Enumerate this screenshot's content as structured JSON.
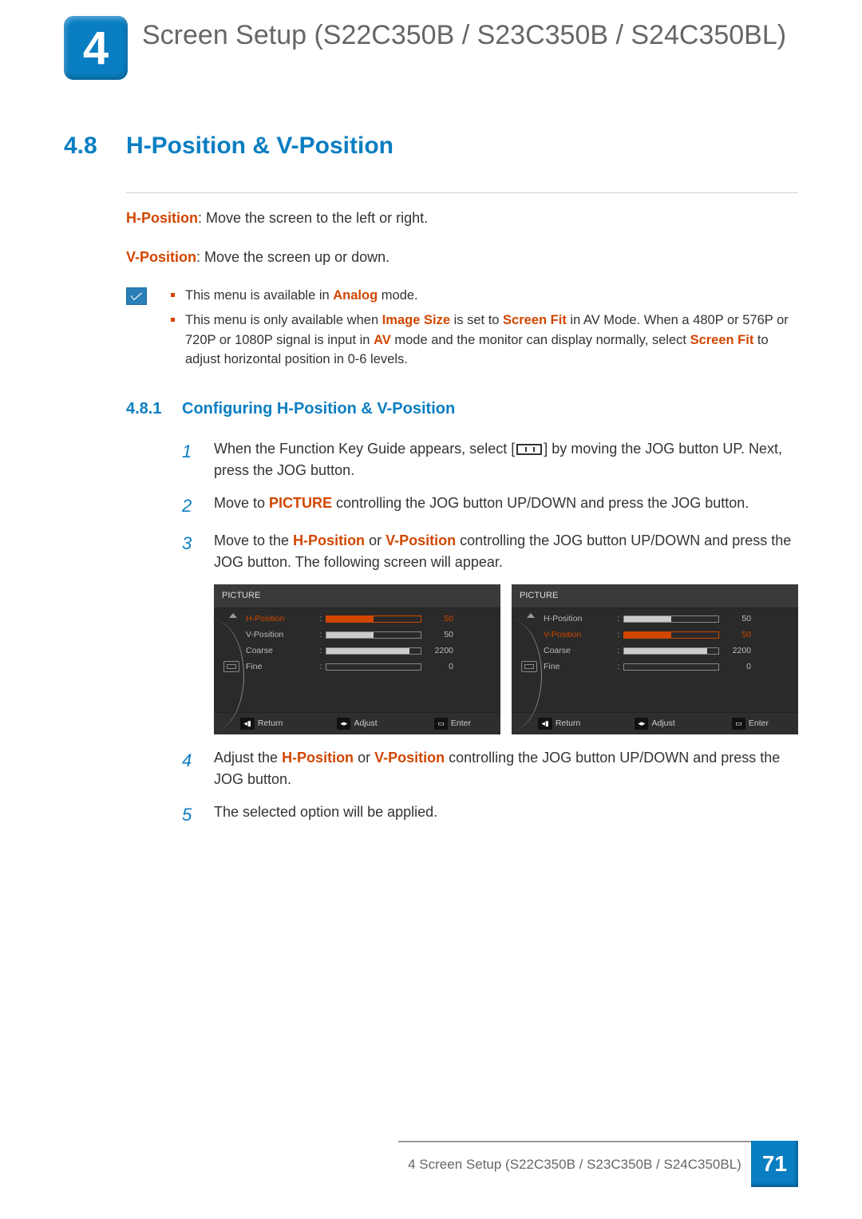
{
  "chapter": {
    "number": "4",
    "title": "Screen Setup (S22C350B / S23C350B / S24C350BL)"
  },
  "section": {
    "number": "4.8",
    "title": "H-Position & V-Position"
  },
  "defs": {
    "hpos_term": "H-Position",
    "hpos_text": ": Move the screen to the left or right.",
    "vpos_term": "V-Position",
    "vpos_text": ": Move the screen up or down."
  },
  "notes": {
    "n1_a": "This menu is available in ",
    "n1_hl": "Analog",
    "n1_b": " mode.",
    "n2_a": "This menu is only available when ",
    "n2_hl1": "Image Size",
    "n2_b": " is set to ",
    "n2_hl2": "Screen Fit",
    "n2_c": " in AV Mode. When a 480P or 576P or 720P or 1080P signal is input in ",
    "n2_hl3": "AV",
    "n2_d": " mode and the monitor can display normally, select ",
    "n2_hl4": "Screen Fit",
    "n2_e": " to adjust horizontal position in 0-6 levels."
  },
  "subsection": {
    "number": "4.8.1",
    "title": "Configuring H-Position & V-Position"
  },
  "steps": {
    "s1a": "When the Function Key Guide appears, select [",
    "s1b": "] by moving the JOG button UP. Next, press the JOG button.",
    "s2a": "Move to ",
    "s2hl": "PICTURE",
    "s2b": " controlling the JOG button UP/DOWN and press the JOG button.",
    "s3a": "Move to the ",
    "s3hl1": "H-Position",
    "s3b": " or  ",
    "s3hl2": "V-Position",
    "s3c": " controlling the JOG button UP/DOWN and press the JOG button. The following screen will appear.",
    "s4a": "Adjust the ",
    "s4hl1": "H-Position",
    "s4b": " or ",
    "s4hl2": "V-Position",
    "s4c": " controlling the JOG button UP/DOWN and press the JOG button.",
    "s5": "The selected option will be applied."
  },
  "osd": {
    "title": "PICTURE",
    "items": [
      {
        "label": "H-Position",
        "value": "50",
        "fill": 50
      },
      {
        "label": "V-Position",
        "value": "50",
        "fill": 50
      },
      {
        "label": "Coarse",
        "value": "2200",
        "fill": 88
      },
      {
        "label": "Fine",
        "value": "0",
        "fill": 0
      }
    ],
    "footer": {
      "return": "Return",
      "adjust": "Adjust",
      "enter": "Enter"
    },
    "active_left": 0,
    "active_right": 1
  },
  "footer": {
    "text": "4 Screen Setup (S22C350B / S23C350B / S24C350BL)",
    "page": "71"
  }
}
